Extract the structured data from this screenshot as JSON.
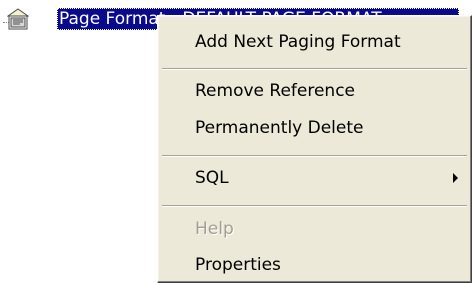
{
  "tree": {
    "node_label": "Page Format - DEFAULT PAGE FORMAT",
    "node_icon": "page-format-icon"
  },
  "context_menu": {
    "add_next_paging_format": "Add Next Paging Format",
    "remove_reference": "Remove Reference",
    "permanently_delete": "Permanently Delete",
    "sql": "SQL",
    "sql_icon": "submenu-arrow-icon",
    "help": "Help",
    "properties": "Properties"
  }
}
